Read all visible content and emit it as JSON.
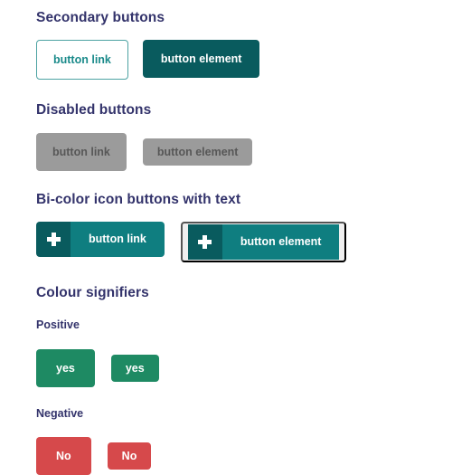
{
  "colors": {
    "teal_dark": "#095b5e",
    "teal_mid": "#0f7e80",
    "teal_border": "#4da3a3",
    "teal_text": "#1a8a8a",
    "gray_disabled_bg": "#9b9b9b",
    "gray_disabled_text": "#575757",
    "green_positive": "#1e8a63",
    "red_negative": "#d6494b",
    "heading": "#33336b",
    "background": "#ffffff"
  },
  "sections": {
    "secondary": {
      "heading": "Secondary buttons",
      "link_label": "button link",
      "element_label": "button element"
    },
    "disabled": {
      "heading": "Disabled buttons",
      "link_label": "button link",
      "element_label": "button element"
    },
    "bicolor": {
      "heading": "Bi-color icon buttons with text",
      "icon": "plus-icon",
      "link_label": "button link",
      "element_label": "button element"
    },
    "signifiers": {
      "heading": "Colour signifiers",
      "positive": {
        "label": "Positive",
        "large_label": "yes",
        "small_label": "yes"
      },
      "negative": {
        "label": "Negative",
        "large_label": "No",
        "small_label": "No"
      }
    }
  }
}
